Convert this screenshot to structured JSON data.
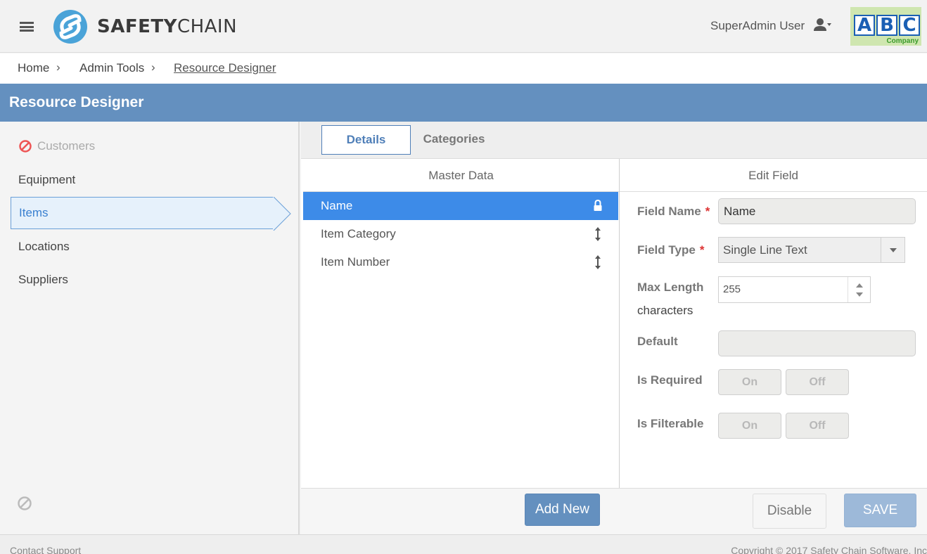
{
  "header": {
    "menu_icon": "hamburger-icon",
    "brand": {
      "bold": "SAFETY",
      "light": "CHAIN",
      "icon": "safetychain-logo-icon"
    },
    "user_name": "SuperAdmin User",
    "user_icon": "user-settings-icon",
    "company_logo": {
      "letters": [
        "A",
        "B",
        "C"
      ],
      "caption": "Company"
    }
  },
  "breadcrumb": {
    "items": [
      "Home",
      "Admin Tools",
      "Resource Designer"
    ],
    "separator": "›"
  },
  "page_title": "Resource Designer",
  "sidebar": {
    "items": [
      {
        "label": "Customers",
        "state": "disabled",
        "icon": "blocked-icon"
      },
      {
        "label": "Equipment",
        "state": "normal"
      },
      {
        "label": "Items",
        "state": "active"
      },
      {
        "label": "Locations",
        "state": "normal"
      },
      {
        "label": "Suppliers",
        "state": "normal"
      }
    ],
    "bottom_icon": "blocked-icon"
  },
  "tabs": [
    {
      "label": "Details",
      "active": true
    },
    {
      "label": "Categories",
      "active": false
    }
  ],
  "master_data": {
    "heading": "Master Data",
    "rows": [
      {
        "label": "Name",
        "selected": true,
        "icon": "lock-icon"
      },
      {
        "label": "Item Category",
        "selected": false,
        "icon": "reorder-arrow-icon"
      },
      {
        "label": "Item Number",
        "selected": false,
        "icon": "reorder-arrow-icon"
      }
    ],
    "add_button": "Add New"
  },
  "edit_field": {
    "heading": "Edit Field",
    "field_name_label": "Field Name",
    "field_name_value": "Name",
    "field_type_label": "Field Type",
    "field_type_value": "Single Line Text",
    "required_mark": "*",
    "max_length_label": "Max Length",
    "max_length_value": "255",
    "max_length_unit": "characters",
    "default_label": "Default",
    "default_value": "",
    "is_required_label": "Is Required",
    "is_filterable_label": "Is Filterable",
    "toggle_on": "On",
    "toggle_off": "Off",
    "disable_button": "Disable",
    "save_button": "SAVE"
  },
  "footer": {
    "contact": "Contact Support",
    "copyright": "Copyright © 2017 Safety Chain Software, Inc"
  },
  "colors": {
    "title_bar": "#6490bf",
    "selected_row": "#3d8be8",
    "active_sidebar": "#e6f1fb",
    "required_mark": "#dd3333"
  }
}
